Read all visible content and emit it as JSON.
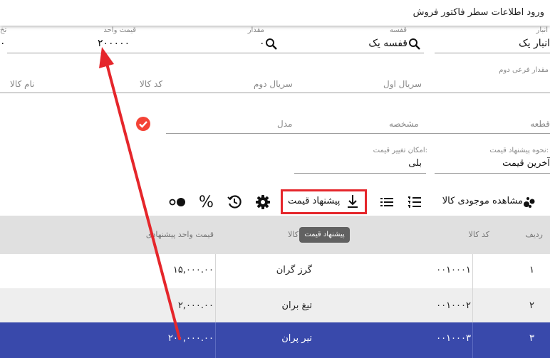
{
  "window": {
    "title": "ورود اطلاعات سطر فاکتور فروش"
  },
  "form": {
    "warehouse": {
      "label": "انبار",
      "value": "انبار یک"
    },
    "shelf": {
      "label": "قفسه",
      "value": "قفسه یک"
    },
    "quantity": {
      "label": "مقدار",
      "value": "۰"
    },
    "unit_price": {
      "label": "قیمت واحد",
      "value": "۲۰۰۰۰۰"
    },
    "discount": {
      "label": "تخ",
      "value": "۰"
    },
    "sub_qty2": {
      "label": "مقدار فرعی دوم"
    },
    "serial1": {
      "placeholder": "سریال اول"
    },
    "serial2": {
      "placeholder": "سریال دوم"
    },
    "item_code": {
      "placeholder": "کد کالا"
    },
    "item_name": {
      "placeholder": "نام کالا"
    },
    "part": {
      "placeholder": "قطعه"
    },
    "spec": {
      "placeholder": "مشخصه"
    },
    "model": {
      "placeholder": "مدل"
    },
    "price_suggest_method": {
      "label": "نحوه پیشنهاد قیمت:",
      "value": "آخرین قیمت"
    },
    "price_change_allowed": {
      "label": "امکان تغییر قیمت:",
      "value": "بلی"
    }
  },
  "toolbar": {
    "stock_view": "مشاهده موجودی کالا",
    "price_suggest": "پیشنهاد قیمت",
    "percent": "%",
    "tooltip": "پیشنهاد قیمت"
  },
  "table": {
    "headers": {
      "row": "ردیف",
      "code": "کد کالا",
      "name": "کالا",
      "price": "قیمت واحد پیشنهادی"
    },
    "rows": [
      {
        "row": "۱",
        "code": "۰۰۱۰۰۰۱",
        "name": "گرز گران",
        "price": "۱۵,۰۰۰.۰۰"
      },
      {
        "row": "۲",
        "code": "۰۰۱۰۰۰۲",
        "name": "تیغ بران",
        "price": "۲,۰۰۰.۰۰"
      },
      {
        "row": "۳",
        "code": "۰۰۱۰۰۰۳",
        "name": "تیر پران",
        "price": "۲۰۰,۰۰۰.۰۰"
      }
    ]
  },
  "colors": {
    "accent": "#3f51b5",
    "selected_row": "#3949ab",
    "annotation_red": "#e5262b",
    "check_red": "#f44336",
    "header_bg": "#e0e0e0",
    "alt_row": "#eeeeee"
  }
}
